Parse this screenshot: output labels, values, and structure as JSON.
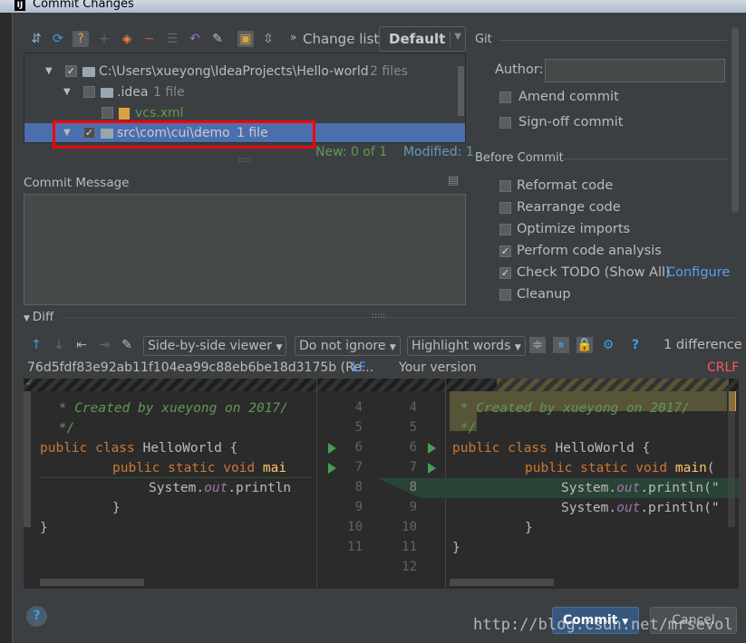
{
  "window": {
    "title": "Commit Changes"
  },
  "toolbar": {
    "changelist_label": "Change list:",
    "changelist_value": "Default"
  },
  "tree": {
    "rows": [
      {
        "label": "C:\\Users\\xueyong\\IdeaProjects\\Hello-world",
        "count": "2 files",
        "checked": true
      },
      {
        "label": ".idea",
        "count": "1 file",
        "checked": false
      },
      {
        "label": "vcs.xml",
        "count": "",
        "checked": false
      },
      {
        "label": "src\\com\\cui\\demo",
        "count": "1 file",
        "checked": true,
        "selected": true
      }
    ],
    "new_count": "New: 0 of 1",
    "modified_count": "Modified: 1"
  },
  "commit_message": {
    "label": "Commit Message",
    "value": ""
  },
  "git": {
    "title": "Git",
    "author_label": "Author:",
    "author_value": "",
    "amend": "Amend commit",
    "signoff": "Sign-off commit"
  },
  "before_commit": {
    "title": "Before Commit",
    "options": [
      {
        "label": "Reformat code",
        "checked": false
      },
      {
        "label": "Rearrange code",
        "checked": false
      },
      {
        "label": "Optimize imports",
        "checked": false
      },
      {
        "label": "Perform code analysis",
        "checked": true
      },
      {
        "label": "Check TODO (Show All)",
        "checked": true
      },
      {
        "label": "Cleanup",
        "checked": false
      }
    ],
    "configure_link": "Configure"
  },
  "diff": {
    "label": "Diff",
    "viewer": "Side-by-side viewer",
    "ignore": "Do not ignore",
    "highlight": "Highlight words",
    "differences": "1 difference",
    "left_title": "76d5fdf83e92ab11f104ea99c88eb6be18d3175b (Re...",
    "left_sep": "LF",
    "right_title": "Your version",
    "right_sep": "CRLF",
    "left_numbers": [
      "4",
      "5",
      "6",
      "7",
      "8",
      "9",
      "10",
      "11"
    ],
    "right_numbers": [
      "4",
      "5",
      "6",
      "7",
      "8",
      "9",
      "10",
      "11",
      "12"
    ]
  },
  "buttons": {
    "commit": "Commit",
    "cancel": "Cancel",
    "help": "?"
  },
  "watermark": "http://blog.csdn.net/mrsevol",
  "colors": {
    "accent": "#4b6eaf",
    "added": "#294436",
    "changed": "#575437",
    "keyword": "#cc7832"
  }
}
